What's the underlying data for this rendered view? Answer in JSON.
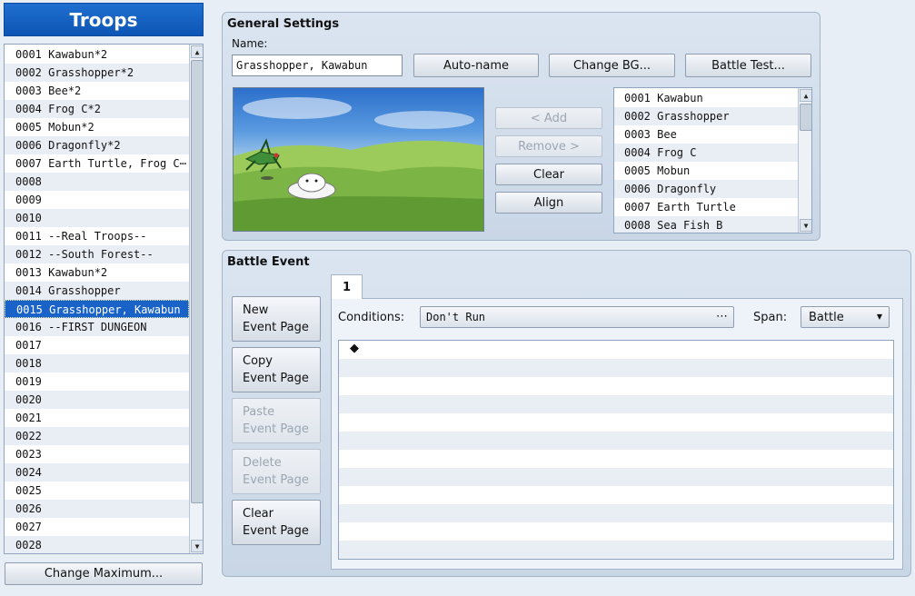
{
  "left": {
    "title": "Troops",
    "troops": [
      "0001 Kawabun*2",
      "0002 Grasshopper*2",
      "0003 Bee*2",
      "0004 Frog C*2",
      "0005 Mobun*2",
      "0006 Dragonfly*2",
      "0007 Earth Turtle, Frog C⋯",
      "0008",
      "0009",
      "0010",
      "0011 --Real Troops--",
      "0012 --South Forest--",
      "0013 Kawabun*2",
      "0014 Grasshopper",
      "0015 Grasshopper, Kawabun",
      "0016 --FIRST DUNGEON",
      "0017",
      "0018",
      "0019",
      "0020",
      "0021",
      "0022",
      "0023",
      "0024",
      "0025",
      "0026",
      "0027",
      "0028"
    ],
    "selected_index": 14,
    "change_max_label": "Change Maximum..."
  },
  "general": {
    "title": "General Settings",
    "name_label": "Name:",
    "name_value": "Grasshopper, Kawabun",
    "autoname_label": "Auto-name",
    "change_bg_label": "Change BG...",
    "battle_test_label": "Battle Test...",
    "add_label": "< Add",
    "remove_label": "Remove >",
    "clear_label": "Clear",
    "align_label": "Align",
    "enemies": [
      "0001 Kawabun",
      "0002 Grasshopper",
      "0003 Bee",
      "0004 Frog C",
      "0005 Mobun",
      "0006 Dragonfly",
      "0007 Earth Turtle",
      "0008 Sea Fish B"
    ]
  },
  "battle_event": {
    "title": "Battle Event",
    "new_line1": "New",
    "new_line2": "Event Page",
    "copy_line1": "Copy",
    "copy_line2": "Event Page",
    "paste_line1": "Paste",
    "paste_line2": "Event Page",
    "delete_line1": "Delete",
    "delete_line2": "Event Page",
    "clear_line1": "Clear",
    "clear_line2": "Event Page",
    "tab_label": "1",
    "conditions_label": "Conditions:",
    "conditions_value": "Don't Run",
    "conditions_more": "⋯",
    "span_label": "Span:",
    "span_value": "Battle",
    "first_command_marker": "◆"
  }
}
